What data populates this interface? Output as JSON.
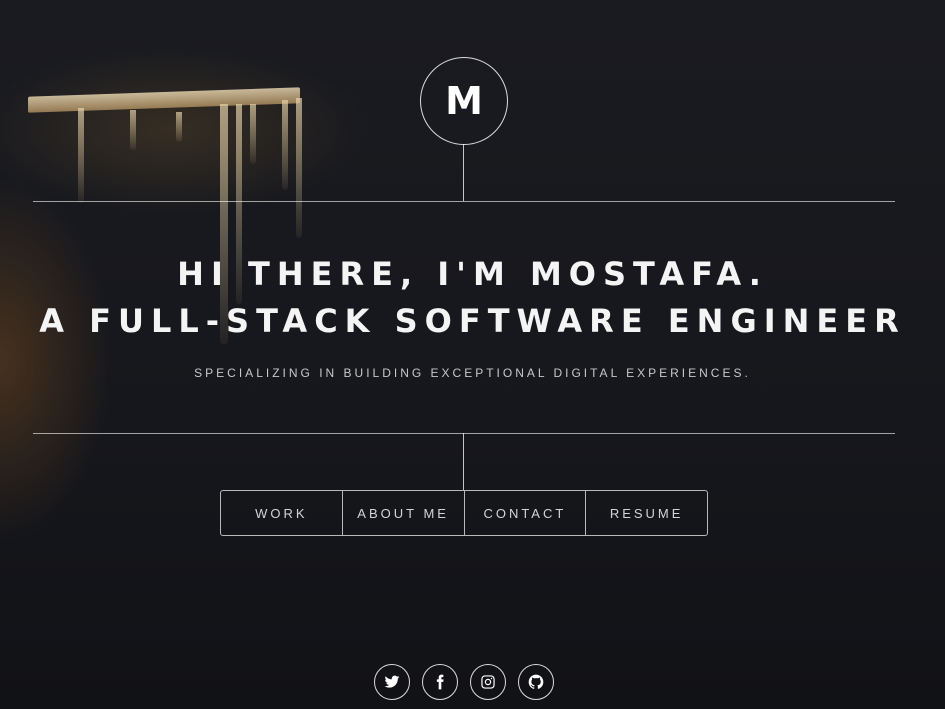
{
  "logo": {
    "letter": "M"
  },
  "hero": {
    "line1": "HI THERE, I'M MOSTAFA.",
    "line2": "A FULL-STACK SOFTWARE ENGINEER",
    "tagline": "SPECIALIZING IN BUILDING EXCEPTIONAL DIGITAL EXPERIENCES."
  },
  "nav": {
    "items": [
      {
        "label": "WORK"
      },
      {
        "label": "ABOUT ME"
      },
      {
        "label": "CONTACT"
      },
      {
        "label": "RESUME"
      }
    ]
  },
  "social": [
    {
      "icon": "twitter-icon"
    },
    {
      "icon": "facebook-icon"
    },
    {
      "icon": "instagram-icon"
    },
    {
      "icon": "github-icon"
    }
  ]
}
